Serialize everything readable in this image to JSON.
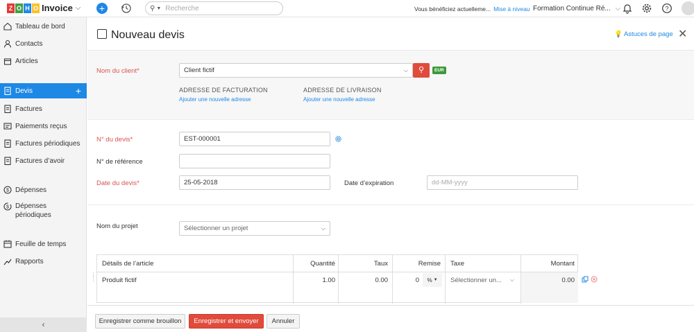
{
  "app": {
    "logo_letters": [
      "Z",
      "O",
      "H",
      "O"
    ],
    "logo_colors": [
      "#e53935",
      "#43a047",
      "#1e88e5",
      "#fbc02d"
    ],
    "product": "Invoice"
  },
  "topbar": {
    "search_placeholder": "Recherche",
    "notice_text": "Vous bénéficiez actuelleme...",
    "notice_link": "Mise à niveau",
    "org_name": "Formation Continue Ré..."
  },
  "sidebar": {
    "items": [
      {
        "label": "Tableau de bord",
        "icon": "home-icon"
      },
      {
        "label": "Contacts",
        "icon": "user-icon"
      },
      {
        "label": "Articles",
        "icon": "box-icon"
      },
      {
        "label": "Devis",
        "icon": "document-icon",
        "active": true
      },
      {
        "label": "Factures",
        "icon": "document-icon"
      },
      {
        "label": "Paiements reçus",
        "icon": "payment-icon"
      },
      {
        "label": "Factures périodiques",
        "icon": "document-icon"
      },
      {
        "label": "Factures d’avoir",
        "icon": "document-icon"
      },
      {
        "label": "Dépenses",
        "icon": "coin-icon"
      },
      {
        "label": "Dépenses périodiques",
        "icon": "recurring-coin-icon"
      },
      {
        "label": "Feuille de temps",
        "icon": "calendar-icon"
      },
      {
        "label": "Rapports",
        "icon": "chart-icon"
      }
    ],
    "collapse_glyph": "‹"
  },
  "header": {
    "title": "Nouveau devis",
    "tips": "Astuces de page",
    "close_glyph": "✕"
  },
  "customer": {
    "label": "Nom du client*",
    "value": "Client fictif",
    "currency": "EUR",
    "billing_heading": "ADRESSE DE FACTURATION",
    "billing_link": "Ajouter une nouvelle adresse",
    "shipping_heading": "ADRESSE DE LIVRAISON",
    "shipping_link": "Ajouter une nouvelle adresse"
  },
  "form": {
    "quote_number_label": "N° du devis*",
    "quote_number_value": "EST-000001",
    "reference_label": "N° de référence",
    "reference_value": "",
    "quote_date_label": "Date du devis*",
    "quote_date_value": "25-05-2018",
    "expiry_label": "Date d’expiration",
    "expiry_placeholder": "dd-MM-yyyy",
    "project_label": "Nom du projet",
    "project_placeholder": "Sélectionner un projet"
  },
  "items_table": {
    "headers": {
      "details": "Détails de l’article",
      "quantity": "Quantité",
      "rate": "Taux",
      "discount": "Remise",
      "tax": "Taxe",
      "amount": "Montant"
    },
    "rows": [
      {
        "details": "Produit fictif",
        "quantity": "1.00",
        "rate": "0.00",
        "discount": "0",
        "discount_unit": "%",
        "tax": "Sélectionner un...",
        "amount": "0.00"
      }
    ]
  },
  "footer": {
    "save_draft": "Enregistrer comme brouillon",
    "save_send": "Enregistrer et envoyer",
    "cancel": "Annuler"
  }
}
